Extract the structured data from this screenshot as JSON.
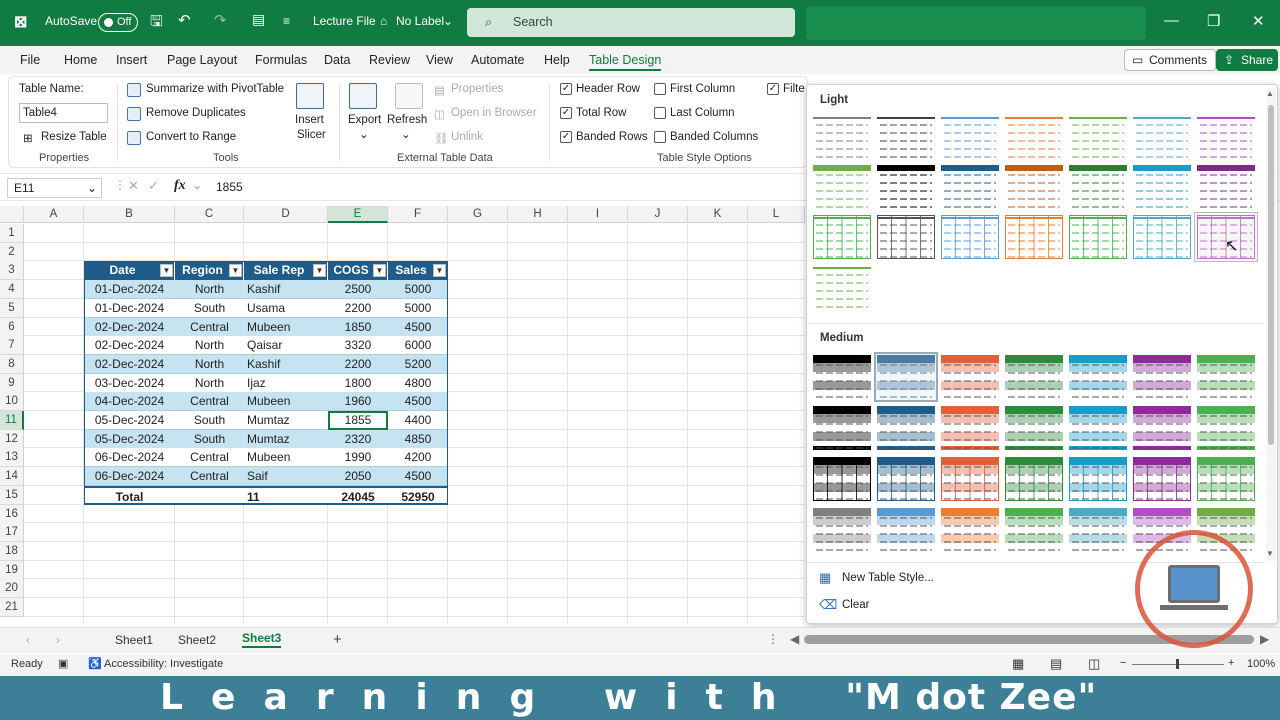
{
  "titlebar": {
    "autosave_label": "AutoSave",
    "autosave_state": "Off",
    "file_name": "Lecture File",
    "label_status": "No Label",
    "search_placeholder": "Search"
  },
  "menu": {
    "items": [
      "File",
      "Home",
      "Insert",
      "Page Layout",
      "Formulas",
      "Data",
      "Review",
      "View",
      "Automate",
      "Help",
      "Table Design"
    ],
    "comments": "Comments",
    "share": "Share"
  },
  "ribbon": {
    "table_name_label": "Table Name:",
    "table_name_value": "Table4",
    "resize_table": "Resize Table",
    "properties_group": "Properties",
    "summarize": "Summarize with PivotTable",
    "remove_duplicates": "Remove Duplicates",
    "convert_range": "Convert to Range",
    "tools_group": "Tools",
    "insert_slicer_1": "Insert",
    "insert_slicer_2": "Slicer",
    "export": "Export",
    "refresh": "Refresh",
    "properties": "Properties",
    "open_browser": "Open in Browser",
    "unlink": "Unlink",
    "external_group": "External Table Data",
    "header_row": "Header Row",
    "total_row": "Total Row",
    "banded_rows": "Banded Rows",
    "first_column": "First Column",
    "last_column": "Last Column",
    "banded_columns": "Banded Columns",
    "filter_button": "Filte",
    "style_options_group": "Table Style Options"
  },
  "formula": {
    "name_box": "E11",
    "fx": "fx",
    "value": "1855"
  },
  "columns": [
    "A",
    "B",
    "C",
    "D",
    "E",
    "F",
    "G",
    "H",
    "I",
    "J",
    "K",
    "L"
  ],
  "rows": [
    "1",
    "2",
    "3",
    "4",
    "5",
    "6",
    "7",
    "8",
    "9",
    "10",
    "11",
    "12",
    "13",
    "14",
    "15",
    "16",
    "17",
    "18",
    "19",
    "20",
    "21"
  ],
  "table": {
    "headers": [
      "Date",
      "Region",
      "Sale Rep",
      "COGS",
      "Sales"
    ],
    "rows": [
      [
        "01-Dec-2024",
        "North",
        "Kashif",
        "2500",
        "5000"
      ],
      [
        "01-Dec-2024",
        "South",
        "Usama",
        "2200",
        "5000"
      ],
      [
        "02-Dec-2024",
        "Central",
        "Mubeen",
        "1850",
        "4500"
      ],
      [
        "02-Dec-2024",
        "North",
        "Qaisar",
        "3320",
        "6000"
      ],
      [
        "02-Dec-2024",
        "North",
        "Kashif",
        "2200",
        "5200"
      ],
      [
        "03-Dec-2024",
        "North",
        "Ijaz",
        "1800",
        "4800"
      ],
      [
        "04-Dec-2024",
        "Central",
        "Mubeen",
        "1960",
        "4500"
      ],
      [
        "05-Dec-2024",
        "South",
        "Mumtaz",
        "1855",
        "4400"
      ],
      [
        "05-Dec-2024",
        "South",
        "Mumtaz",
        "2320",
        "4850"
      ],
      [
        "06-Dec-2024",
        "Central",
        "Mubeen",
        "1990",
        "4200"
      ],
      [
        "06-Dec-2024",
        "Central",
        "Saif",
        "2050",
        "4500"
      ]
    ],
    "total": [
      "Total",
      "",
      "11",
      "24045",
      "52950"
    ]
  },
  "gallery": {
    "light_label": "Light",
    "medium_label": "Medium",
    "new_style": "New Table Style...",
    "clear": "Clear",
    "light_colors": [
      "#808080",
      "#404040",
      "#5b9bd5",
      "#ed7d31",
      "#70ad47",
      "#4bacc6",
      "#b04fc5",
      "#70ad47",
      "#000000",
      "#1f5c8a",
      "#c55a11",
      "#2e7d32",
      "#1a9cc8",
      "#7b2c8a",
      "#4caf50",
      "#555555",
      "#5b9bd5",
      "#ed7d31",
      "#4caf50",
      "#4bacc6",
      "#b04fc5",
      "#70ad47"
    ],
    "medium_colors": [
      "#000000",
      "#1f5c8a",
      "#e0603a",
      "#2e8b3e",
      "#1a9cc8",
      "#8e2a9a",
      "#4caf50",
      "#000000",
      "#1f5c8a",
      "#e0603a",
      "#2e8b3e",
      "#1a9cc8",
      "#8e2a9a",
      "#4caf50",
      "#000000",
      "#1f5c8a",
      "#e0603a",
      "#2e8b3e",
      "#1a9cc8",
      "#8e2a9a",
      "#4caf50",
      "#808080",
      "#5b9bd5",
      "#ed7d31",
      "#4caf50",
      "#4bacc6",
      "#b04fc5",
      "#70ad47"
    ]
  },
  "sheets": [
    "Sheet1",
    "Sheet2",
    "Sheet3"
  ],
  "status": {
    "ready": "Ready",
    "accessibility": "Accessibility: Investigate",
    "zoom": "100%"
  },
  "banner": {
    "text": "L  e  a  r  n  i  n  g     w  i  t  h     \"M dot Zee\""
  },
  "watermark": {
    "text": "LEARNING WITH M DOT ZEE"
  }
}
